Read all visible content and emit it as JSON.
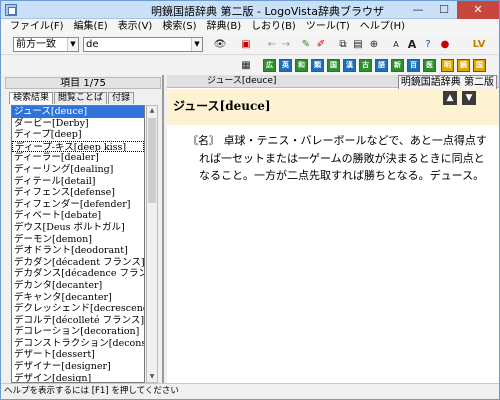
{
  "window": {
    "title": "明鏡国語辞典 第二版 - LogoVista辞典ブラウザ",
    "btn_min": "—",
    "btn_max": "☐",
    "btn_close": "✕"
  },
  "menu": [
    "ファイル(F)",
    "編集(E)",
    "表示(V)",
    "検索(S)",
    "辞典(B)",
    "しおり(B)",
    "ツール(T)",
    "ヘルプ(H)"
  ],
  "toolbar": {
    "search_mode": "前方一致",
    "search_value": "de"
  },
  "left": {
    "header": "項目 1/75",
    "tabs": [
      "検索結果",
      "閲覧ことば",
      "付録"
    ],
    "items": [
      "ジュース[deuce]",
      "ダービー[Derby]",
      "ディープ[deep]",
      "ディープ-キス[deep kiss]",
      "ディーラー[dealer]",
      "ディーリング[dealing]",
      "ディテール[detail]",
      "ディフェンス[defense]",
      "ディフェンダー[defender]",
      "ディベート[debate]",
      "デウス[Deus ポルトガル]",
      "デーモン[demon]",
      "デオドラント[deodorant]",
      "デカダン[décadent フランス]",
      "デカダンス[décadence フランス]",
      "デカンタ[decanter]",
      "デキャンタ[decanter]",
      "デクレッシェンド[decrescendo]",
      "デコルテ[décolleté フランス]",
      "デコレーション[decoration]",
      "デコンストラクション[deconstruction]",
      "デザート[dessert]",
      "デザイナー[designer]",
      "デザイン[design]"
    ]
  },
  "right": {
    "header_word": "ジュース[deuce]",
    "header_dict": "明鏡国語辞典 第二版",
    "entry_title": "ジュース[deuce]",
    "definition": "〘名〙 卓球・テニス・バレーボールなどで、あと一点得点すれば一セットまたは一ゲームの勝敗が決まるときに同点となること。一方が二点先取すれば勝ちとなる。デュース。"
  },
  "status": "ヘルプを表示するには [F1] を押してください"
}
